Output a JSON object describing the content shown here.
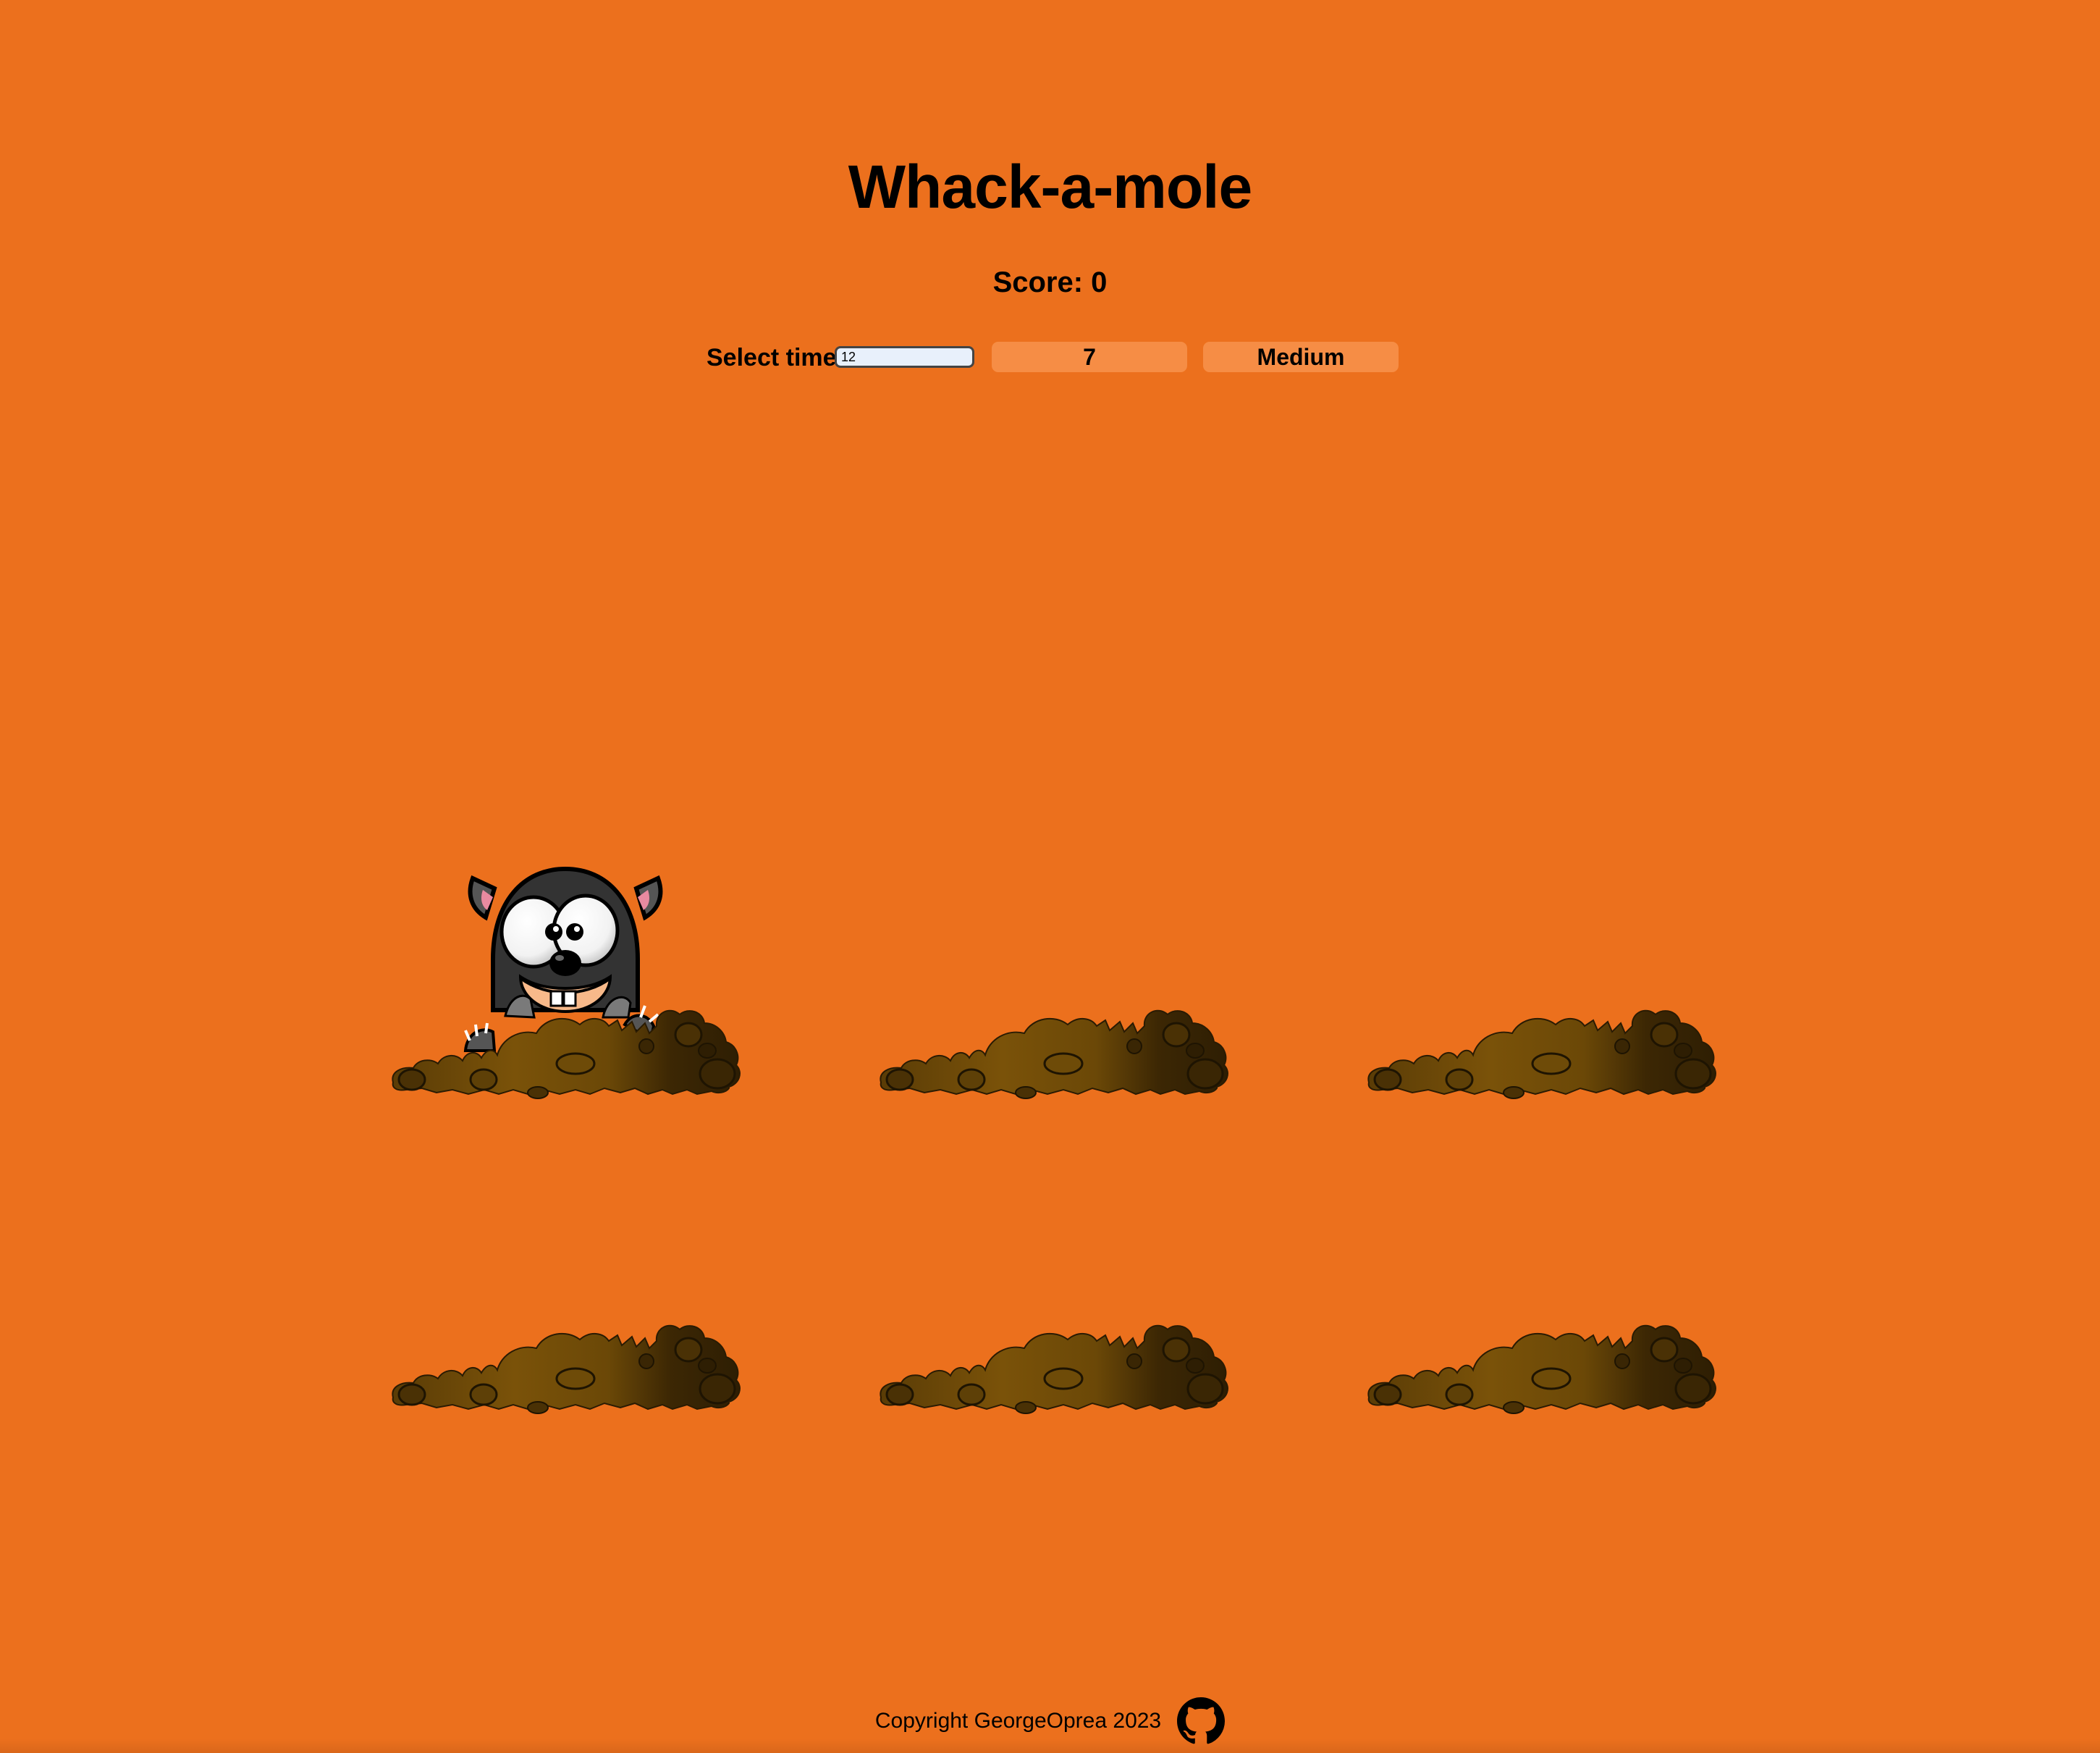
{
  "header": {
    "title": "Whack-a-mole",
    "score_label": "Score: 0"
  },
  "controls": {
    "select_time_label": "Select time",
    "time_input_value": "12",
    "time_button_label": "7",
    "difficulty_button_label": "Medium"
  },
  "board": {
    "holes": [
      {
        "id": 1,
        "has_mole": true
      },
      {
        "id": 2,
        "has_mole": false
      },
      {
        "id": 3,
        "has_mole": false
      },
      {
        "id": 4,
        "has_mole": false
      },
      {
        "id": 5,
        "has_mole": false
      },
      {
        "id": 6,
        "has_mole": false
      }
    ]
  },
  "footer": {
    "copyright": "Copyright GeorgeOprea 2023",
    "icon": "github-icon"
  },
  "colors": {
    "background": "#ec701d",
    "button": "#f68d45",
    "dirt_light": "#7a5209",
    "dirt_dark": "#3a2604",
    "mole_body": "#333333"
  }
}
